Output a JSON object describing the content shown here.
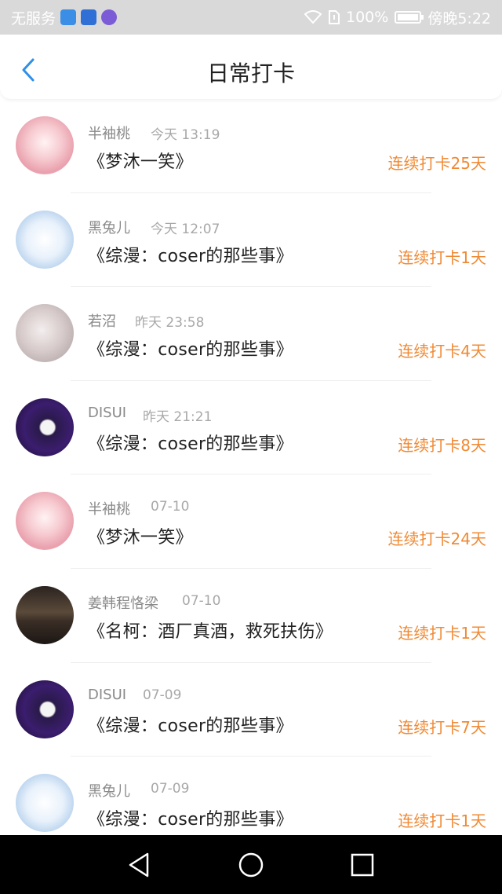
{
  "status_bar": {
    "carrier": "无服务",
    "battery": "100%",
    "time": "傍晚5:22",
    "app_colors": [
      "#3a8ee6",
      "#2f6fd6",
      "#7b5cd6"
    ]
  },
  "header": {
    "title": "日常打卡"
  },
  "entries": [
    {
      "name": "半袖桃",
      "time": "今天 13:19",
      "book": "《梦沐一笑》",
      "streak": "连续打卡25天",
      "avatar": "pink"
    },
    {
      "name": "黑兔儿",
      "time": "今天 12:07",
      "book": "《综漫：coser的那些事》",
      "streak": "连续打卡1天",
      "avatar": "white"
    },
    {
      "name": "若沼",
      "time": "昨天 23:58",
      "book": "《综漫：coser的那些事》",
      "streak": "连续打卡4天",
      "avatar": "grey"
    },
    {
      "name": "DISUI",
      "time": "昨天 21:21",
      "book": "《综漫：coser的那些事》",
      "streak": "连续打卡8天",
      "avatar": "dark"
    },
    {
      "name": "半袖桃",
      "time": "07-10",
      "book": "《梦沐一笑》",
      "streak": "连续打卡24天",
      "avatar": "pink"
    },
    {
      "name": "姜韩程恪梁",
      "time": "07-10",
      "book": "《名柯：酒厂真酒，救死扶伤》",
      "streak": "连续打卡1天",
      "avatar": "room"
    },
    {
      "name": "DISUI",
      "time": "07-09",
      "book": "《综漫：coser的那些事》",
      "streak": "连续打卡7天",
      "avatar": "dark"
    },
    {
      "name": "黑兔儿",
      "time": "07-09",
      "book": "《综漫：coser的那些事》",
      "streak": "连续打卡1天",
      "avatar": "white"
    }
  ],
  "colors": {
    "streak": "#f08a34",
    "back": "#2f8fe8",
    "status_bg": "#d9d9d9"
  }
}
